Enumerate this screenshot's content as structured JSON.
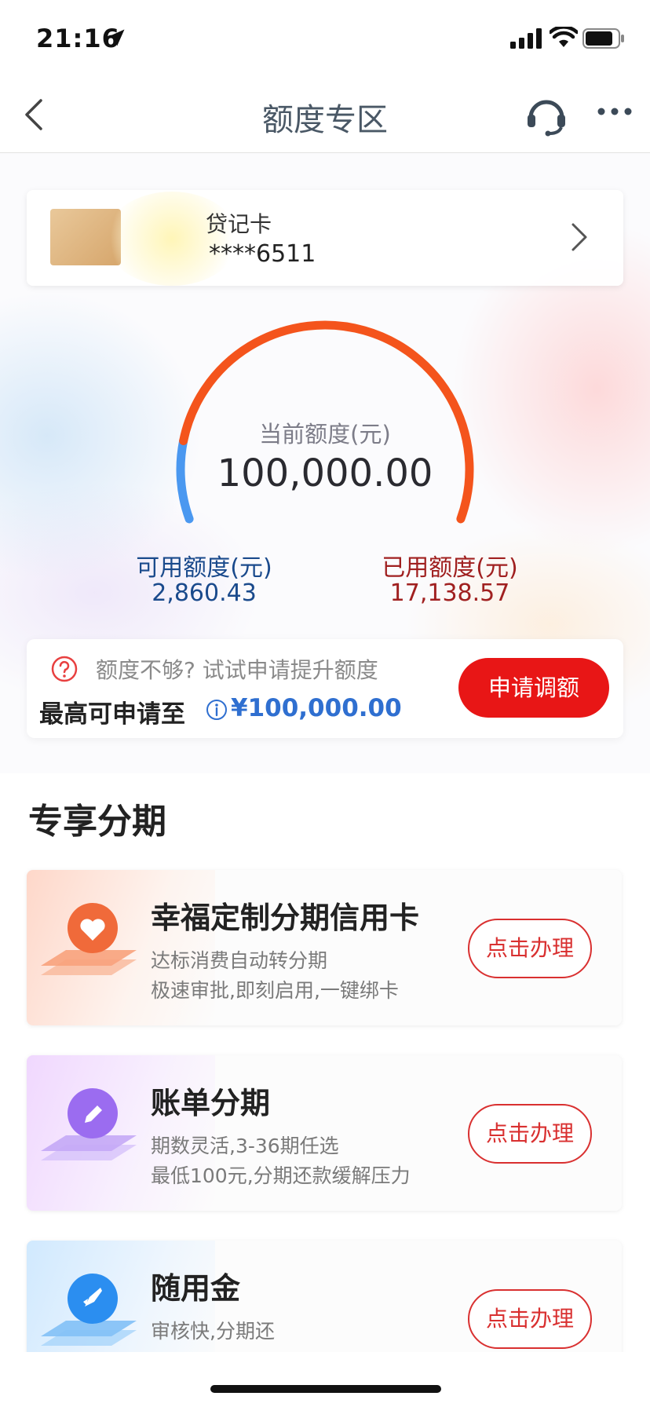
{
  "status_bar": {
    "time": "21:16"
  },
  "nav": {
    "title": "额度专区"
  },
  "card": {
    "name": "贷记卡",
    "number": "****6511"
  },
  "gauge": {
    "label": "当前额度(元)",
    "value": "100,000.00",
    "available_label": "可用额度(元)",
    "available_value": "2,860.43",
    "used_label": "已用额度(元)",
    "used_value": "17,138.57",
    "used_fraction": 0.857,
    "colors": {
      "used": "#f4541c",
      "available": "#4a98f0"
    }
  },
  "limit": {
    "hint": "额度不够? 试试申请提升额度",
    "prefix": "最高可申请至",
    "max": "¥100,000.00",
    "apply_button": "申请调额"
  },
  "section": {
    "title": "专享分期",
    "products": [
      {
        "title": "幸福定制分期信用卡",
        "desc1": "达标消费自动转分期",
        "desc2": "极速审批,即刻启用,一键绑卡",
        "button": "点击办理",
        "icon": "heart-icon",
        "color": "#f06a3a"
      },
      {
        "title": "账单分期",
        "desc1": "期数灵活,3-36期任选",
        "desc2": "最低100元,分期还款缓解压力",
        "button": "点击办理",
        "icon": "pencil-icon",
        "color": "#9b6cf0"
      },
      {
        "title": "随用金",
        "desc1": "审核快,分期还",
        "desc2": "",
        "button": "点击办理",
        "icon": "rocket-icon",
        "color": "#2b8ef0"
      }
    ]
  },
  "colors": {
    "accent_red": "#e81616",
    "blue": "#2f6fd0"
  }
}
